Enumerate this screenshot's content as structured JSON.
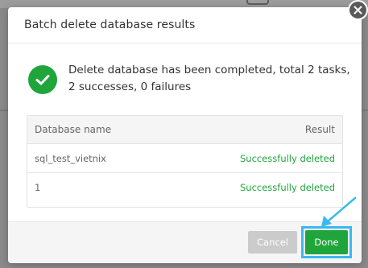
{
  "dialog": {
    "title": "Batch delete database results",
    "summary": "Delete database has been completed, total 2 tasks, 2 successes, 0 failures"
  },
  "table": {
    "columns": [
      "Database name",
      "Result"
    ],
    "rows": [
      {
        "name": "sql_test_vietnix",
        "result": "Successfully deleted"
      },
      {
        "name": "1",
        "result": "Successfully deleted"
      }
    ]
  },
  "footer": {
    "cancel_label": "Cancel",
    "done_label": "Done"
  },
  "icons": {
    "close": "close-icon",
    "success": "check-circle-icon",
    "annotation": "arrow-pointer-icon"
  },
  "colors": {
    "success": "#20a53a",
    "highlight": "#3ab9f0",
    "cancel_disabled": "#cbcbcb"
  }
}
